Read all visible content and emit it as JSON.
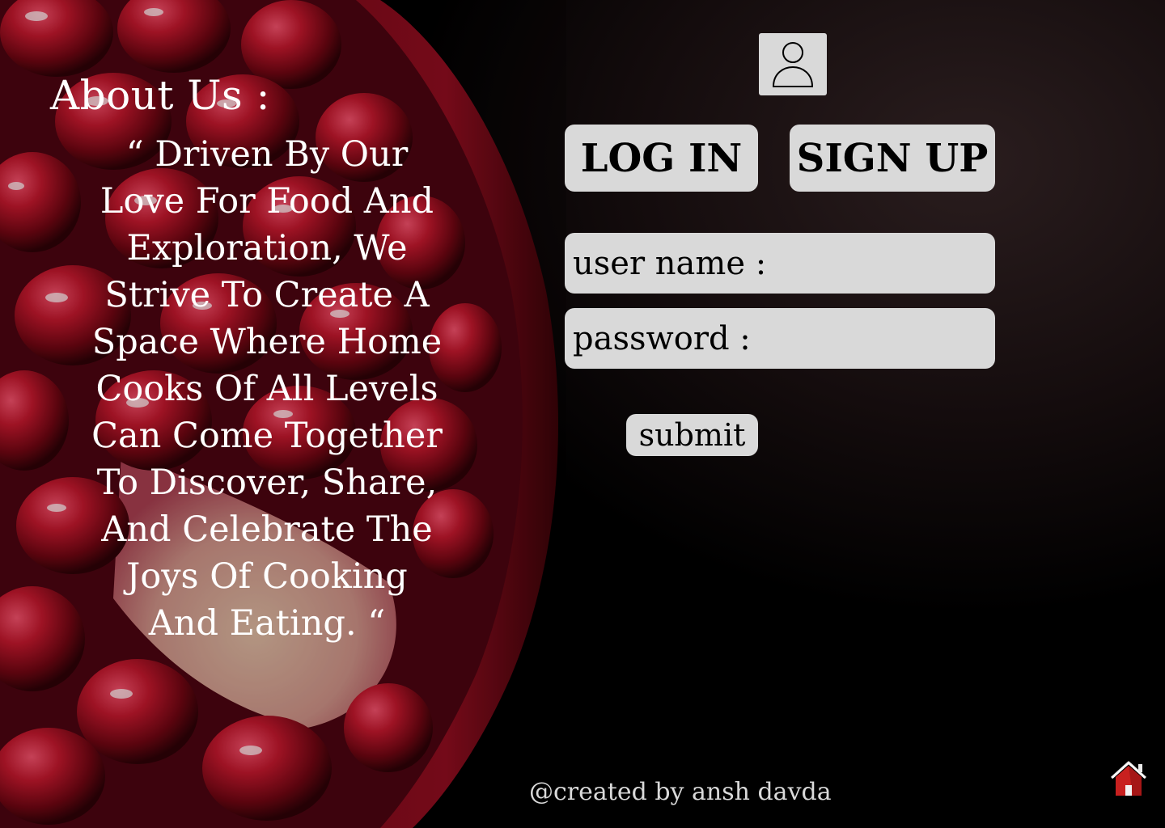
{
  "about": {
    "title": "About Us :",
    "quote": "“ Driven By Our Love For Food And Exploration, We Strive To Create A Space Where Home Cooks Of All Levels Can Come Together To Discover, Share, And Celebrate The Joys Of Cooking And Eating. “"
  },
  "auth": {
    "avatar_icon": "user-icon",
    "login_label": "LOG IN",
    "signup_label": "SIGN UP",
    "username_label": "user name :",
    "username_value": "",
    "password_label": "password :",
    "password_value": "",
    "submit_label": "submit"
  },
  "footer": {
    "credits": "@created by ansh davda",
    "home_icon": "home-icon"
  },
  "colors": {
    "background": "#000000",
    "panel": "#d9d9d9",
    "accent": "#c0172c",
    "text_light": "#ffffff"
  }
}
